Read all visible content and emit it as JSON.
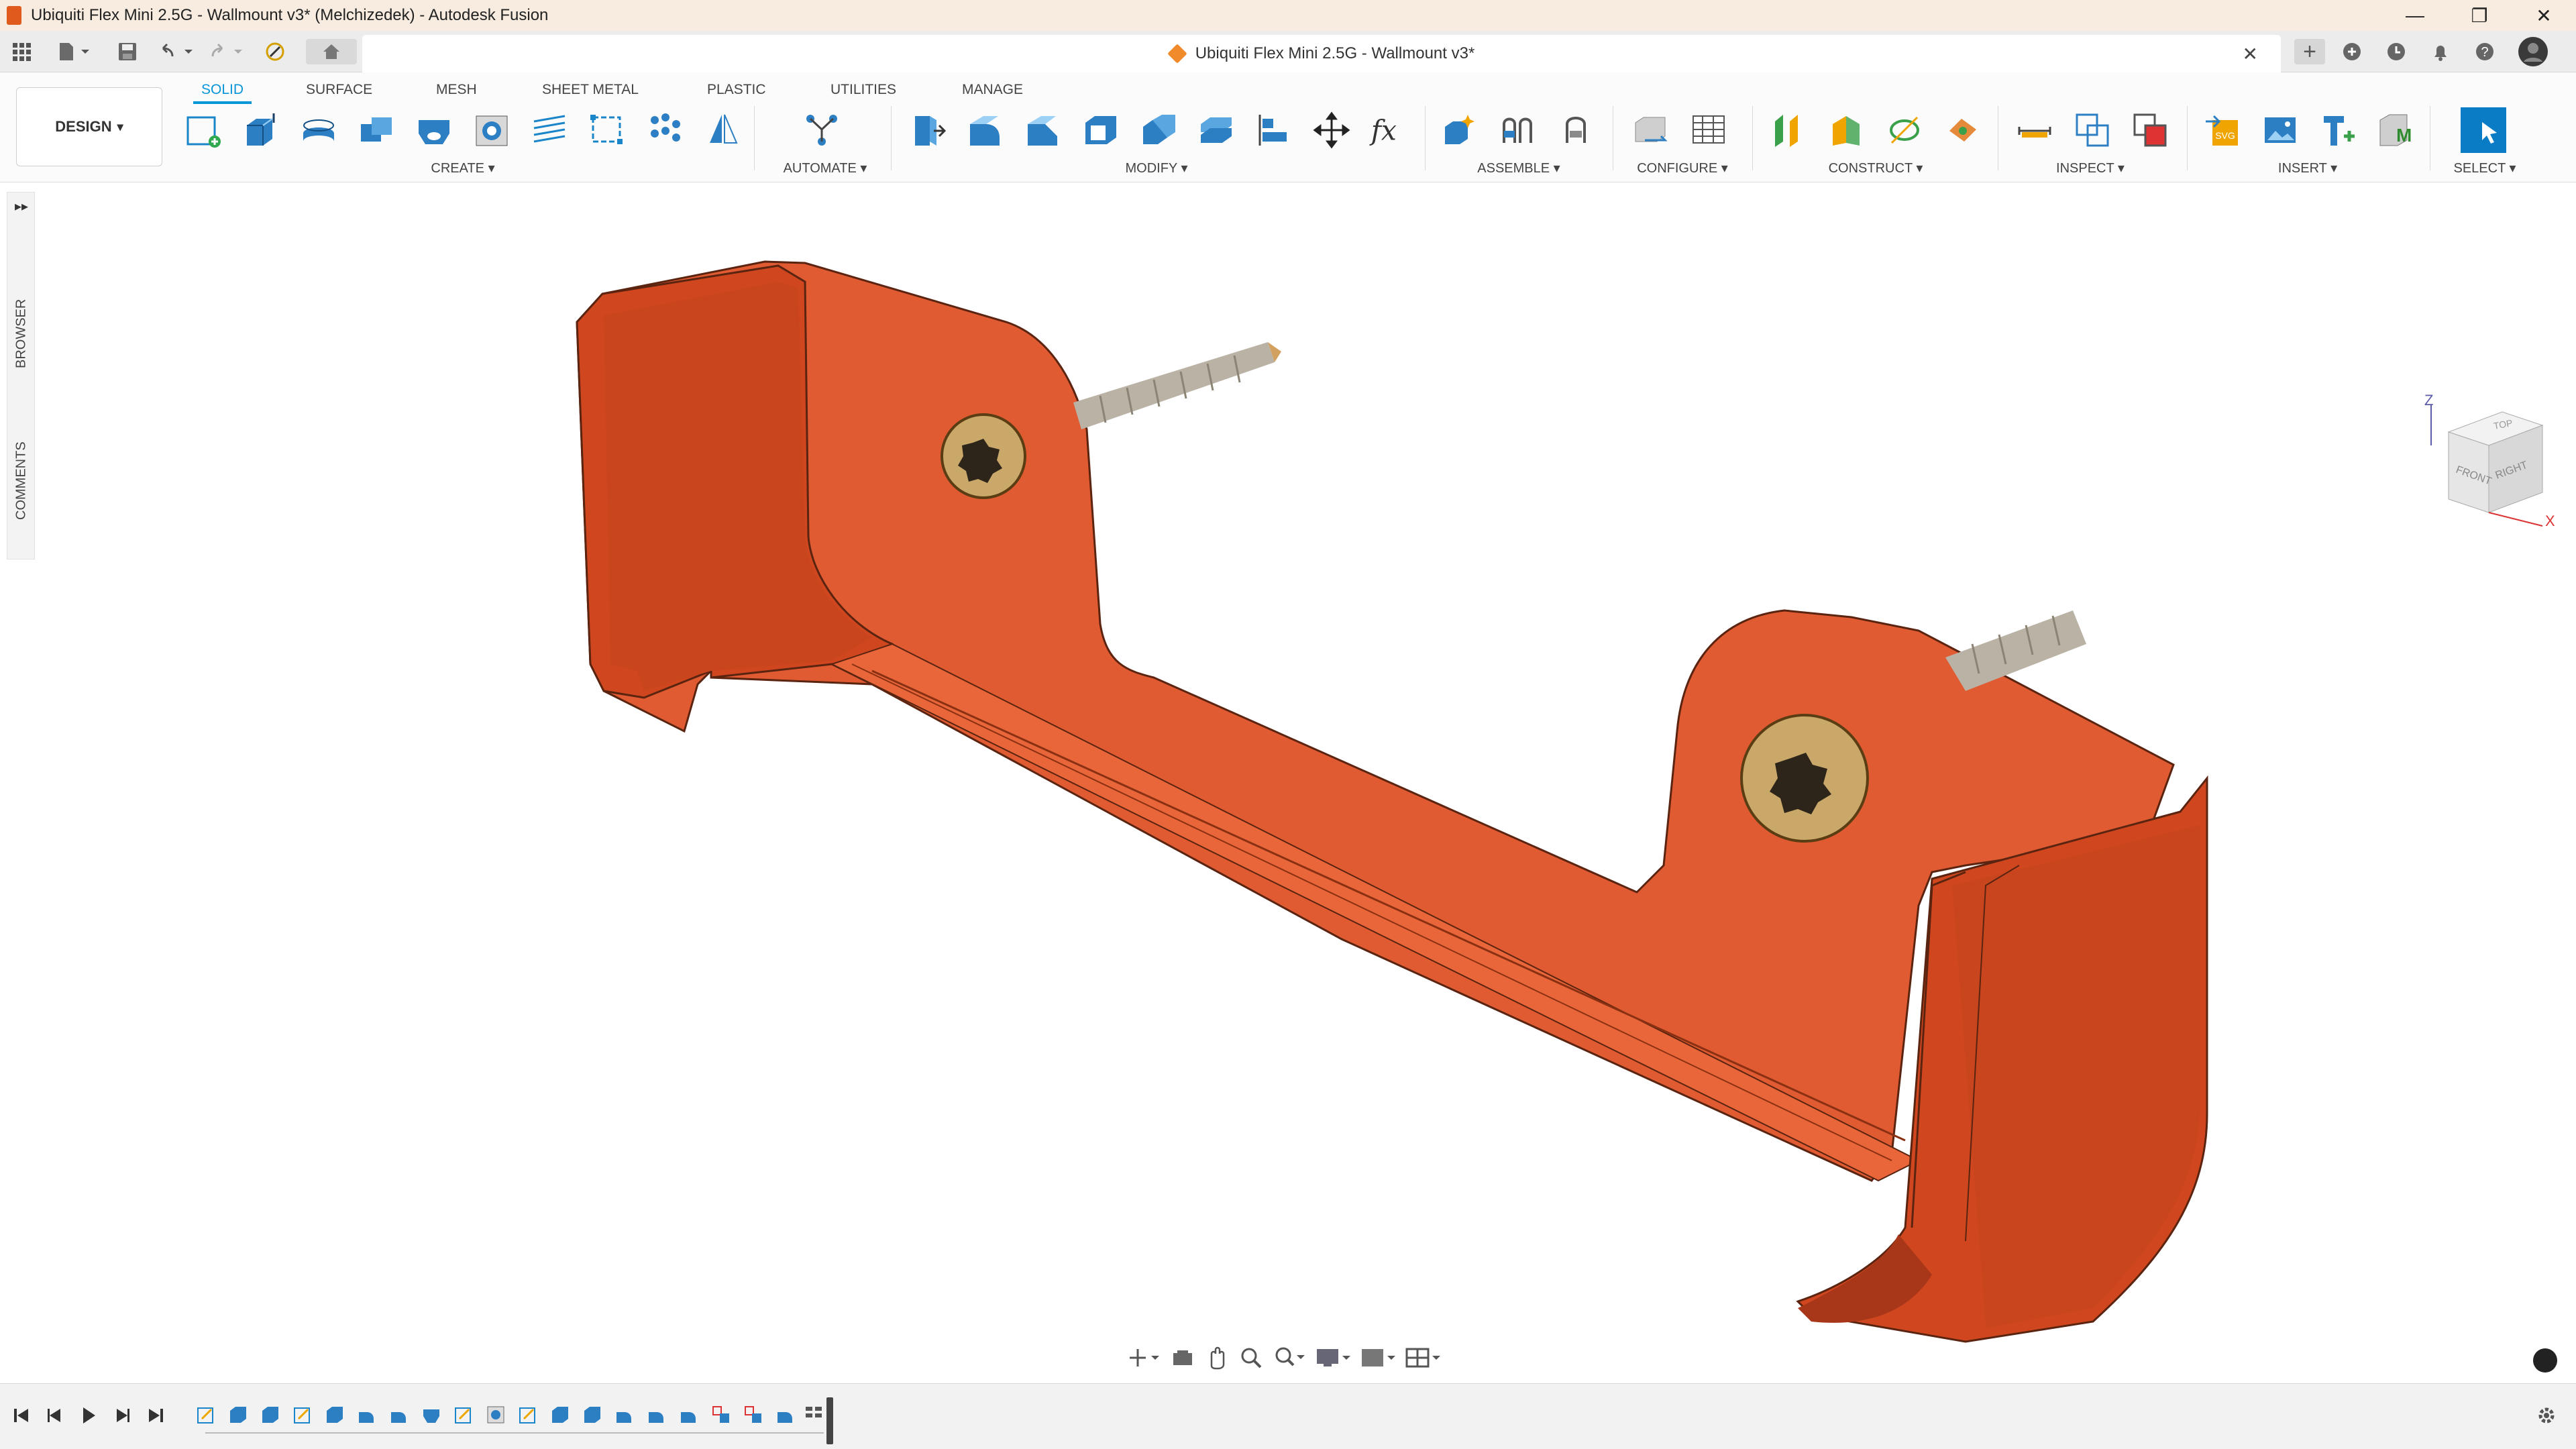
{
  "window": {
    "title": "Ubiquiti Flex Mini 2.5G - Wallmount v3* (Melchizedek) - Autodesk Fusion",
    "controls": {
      "minimize": "—",
      "maximize": "❐",
      "close": "✕"
    }
  },
  "quick_access": {
    "grid_icon": "grid-icon",
    "file_icon": "file-icon",
    "save_icon": "save-icon",
    "undo_icon": "undo-icon",
    "redo_icon": "redo-icon",
    "job_status_icon": "job-status-icon",
    "home_icon": "home-icon"
  },
  "document_tab": {
    "title": "Ubiquiti Flex Mini 2.5G - Wallmount v3*",
    "close": "✕"
  },
  "tab_bar_right": {
    "new_tab": "+",
    "icons": [
      "extensions-icon",
      "clock-icon",
      "bell-icon",
      "help-icon",
      "avatar-icon"
    ]
  },
  "workspace": {
    "label": "DESIGN",
    "caret": "▾"
  },
  "toolbar_tabs": [
    {
      "label": "SOLID",
      "active": true
    },
    {
      "label": "SURFACE",
      "active": false
    },
    {
      "label": "MESH",
      "active": false
    },
    {
      "label": "SHEET METAL",
      "active": false
    },
    {
      "label": "PLASTIC",
      "active": false
    },
    {
      "label": "UTILITIES",
      "active": false
    },
    {
      "label": "MANAGE",
      "active": false
    }
  ],
  "groups": [
    {
      "label": "CREATE ▾"
    },
    {
      "label": "AUTOMATE ▾"
    },
    {
      "label": "MODIFY ▾"
    },
    {
      "label": "ASSEMBLE ▾"
    },
    {
      "label": "CONFIGURE ▾"
    },
    {
      "label": "CONSTRUCT ▾"
    },
    {
      "label": "INSPECT ▾"
    },
    {
      "label": "INSERT ▾"
    },
    {
      "label": "SELECT ▾"
    }
  ],
  "tools": {
    "create": [
      "create-sketch-icon",
      "extrude-icon",
      "revolve-icon",
      "combine-icon",
      "hole-icon",
      "thread-icon",
      "rib-icon",
      "rectangular-pattern-icon",
      "pattern-icon",
      "mirror-icon"
    ],
    "automate": [
      "automate-icon"
    ],
    "modify": [
      "press-pull-icon",
      "fillet-icon",
      "chamfer-icon",
      "shell-icon",
      "combine-icon",
      "offset-face-icon",
      "align-icon",
      "move-icon",
      "parameters-icon"
    ],
    "assemble": [
      "new-component-icon",
      "joint-icon",
      "as-built-joint-icon"
    ],
    "configure": [
      "configure-icon",
      "table-icon"
    ],
    "construct": [
      "offset-plane-icon",
      "plane-at-angle-icon",
      "axis-icon",
      "point-icon"
    ],
    "inspect": [
      "measure-icon",
      "interference-icon",
      "section-analysis-icon"
    ],
    "insert": [
      "insert-svg-icon",
      "insert-image-icon",
      "insert-mcmaster-icon",
      "insert-mesh-icon"
    ],
    "select": [
      "select-icon"
    ]
  },
  "left_panel": {
    "expand": "▸▸",
    "browser_label": "BROWSER",
    "comments_label": "COMMENTS"
  },
  "viewcube": {
    "top": "TOP",
    "front": "FRONT",
    "right": "RIGHT",
    "axis_z": "Z",
    "axis_x": "X"
  },
  "navbar": {
    "icons": [
      "orbit-icon",
      "look-at-icon",
      "pan-icon",
      "zoom-icon",
      "fit-icon",
      "display-settings-icon",
      "visual-style-icon",
      "grid-settings-icon"
    ]
  },
  "timeline": {
    "controls": [
      "skip-start-icon",
      "step-back-icon",
      "play-icon",
      "step-forward-icon",
      "skip-end-icon"
    ],
    "settings_icon": "gear-icon",
    "features": [
      "sketch",
      "extrude",
      "extrude",
      "sketch",
      "extrude",
      "fillet",
      "fillet",
      "hole",
      "sketch",
      "hole",
      "sketch",
      "extrude",
      "extrude",
      "fillet",
      "fillet",
      "fillet",
      "move",
      "move",
      "fillet",
      "group"
    ]
  },
  "colors": {
    "accent": "#0696d7",
    "model_orange": "#e05a32",
    "screw_gold": "#c9a86a",
    "title_bar": "#f7ecdf"
  }
}
